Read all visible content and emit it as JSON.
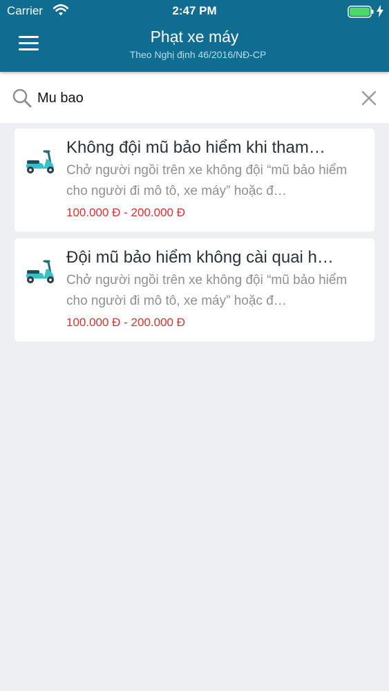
{
  "status_bar": {
    "carrier": "Carrier",
    "time": "2:47 PM"
  },
  "nav": {
    "title": "Phạt xe máy",
    "subtitle": "Theo Nghị định 46/2016/NĐ-CP"
  },
  "search": {
    "value": "Mu bao"
  },
  "results": [
    {
      "title": "Không đội mũ bảo hiểm khi tham…",
      "description": "Chở người ngồi trên xe không đội “mũ bảo hiểm cho người đi mô tô, xe máy” hoặc đ…",
      "fine": "100.000 Đ - 200.000 Đ",
      "icon": "scooter-icon"
    },
    {
      "title": "Đội mũ bảo hiểm không cài quai h…",
      "description": "Chở người ngồi trên xe không đội “mũ bảo hiểm cho người đi mô tô, xe máy” hoặc đ…",
      "fine": "100.000 Đ - 200.000 Đ",
      "icon": "scooter-icon"
    }
  ],
  "colors": {
    "header": "#0f6d91",
    "fine": "#e02f2b",
    "background": "#edeff2",
    "battery": "#4cd964",
    "scooter_body": "#35c1c9"
  }
}
